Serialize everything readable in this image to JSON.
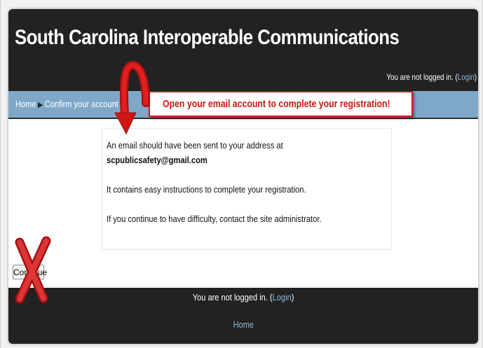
{
  "header": {
    "site_title": "South Carolina Interoperable Communications",
    "login_status_text": "You are not logged in. (",
    "login_link": "Login",
    "login_close": ")"
  },
  "breadcrumb": {
    "home": "Home",
    "separator": "▶",
    "current": "Confirm your account"
  },
  "callout": {
    "text": "Open your email account to complete your registration!"
  },
  "content": {
    "line1": "An email should have been sent to your address at",
    "email": "scpublicsafety@gmail.com",
    "line2": "It contains easy instructions to complete your registration.",
    "line3": "If you continue to have difficulty, contact the site administrator."
  },
  "continue_button": {
    "label": "Continue"
  },
  "footer": {
    "login_status_text": "You are not logged in. (",
    "login_link": "Login",
    "login_close": ")",
    "home_link": "Home"
  },
  "colors": {
    "header_bg": "#222222",
    "nav_bg": "#7fa8c8",
    "link": "#8fb8dd",
    "annotation_red": "#d01515"
  },
  "icons": [
    "curved-arrow-icon",
    "red-x-icon",
    "breadcrumb-arrow-icon"
  ]
}
